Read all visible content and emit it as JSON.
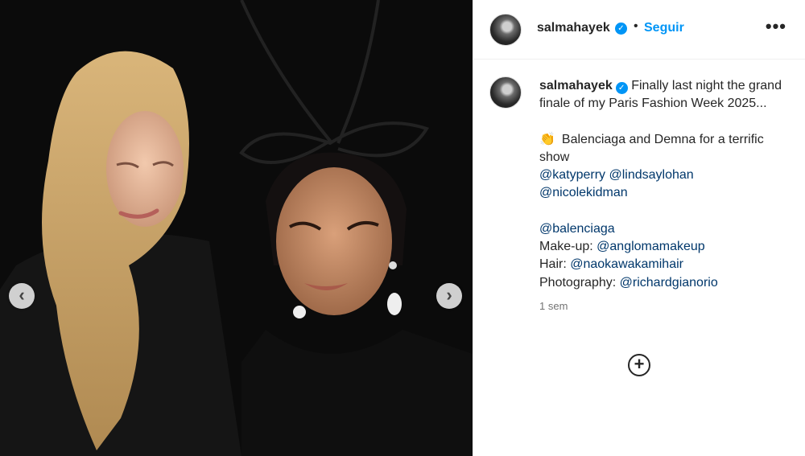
{
  "post": {
    "username": "salmahayek",
    "follow_label": "Seguir",
    "more_label": "•••",
    "verified_glyph": "✓",
    "separator": "•"
  },
  "caption": {
    "username": "salmahayek",
    "line1": "Finally last night the grand finale of my Paris Fashion Week 2025...",
    "clap_emoji": "👏",
    "line2": "Balenciaga and Demna for a terrific show",
    "mentions_row1": [
      "@katyperry",
      "@lindsaylohan"
    ],
    "mentions_row2": [
      "@nicolekidman"
    ],
    "mention_brand": "@balenciaga",
    "makeup_label": "Make-up:",
    "makeup_handle": "@anglomamakeup",
    "hair_label": "Hair:",
    "hair_handle": "@naokawakamihair",
    "photo_label": "Photography:",
    "photo_handle": "@richardgianorio",
    "timestamp": "1 sem"
  },
  "icons": {
    "prev": "‹",
    "next": "›",
    "add": "+"
  },
  "colors": {
    "accent_blue": "#0095f6",
    "mention_blue": "#00376b",
    "text": "#262626",
    "muted": "#737373"
  }
}
